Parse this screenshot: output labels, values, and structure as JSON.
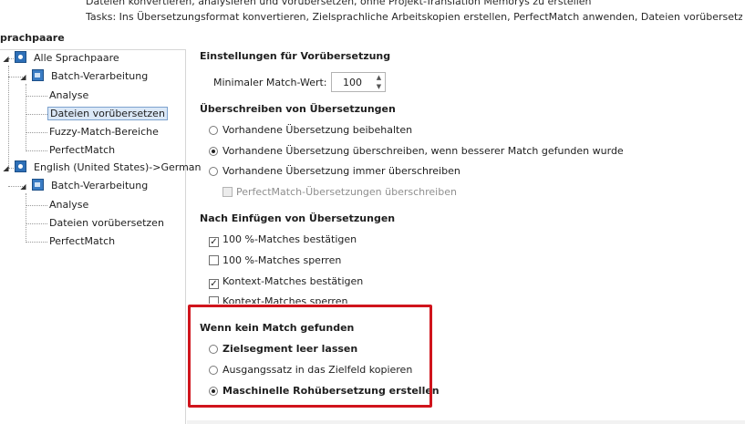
{
  "header": {
    "desc_line1": "Dateien konvertieren, analysieren und vorübersetzen, ohne Projekt-Translation Memorys zu erstellen",
    "desc_line2": "Tasks: Ins Übersetzungsformat konvertieren, Zielsprachliche Arbeitskopien erstellen, PerfectMatch anwenden, Dateien vorübersetzen, Analyse"
  },
  "tree": {
    "title": "prachpaare",
    "nodes": [
      {
        "label": "Alle Sprachpaare"
      },
      {
        "label": "Batch-Verarbeitung"
      },
      {
        "label": "Analyse"
      },
      {
        "label": "Dateien vorübersetzen"
      },
      {
        "label": "Fuzzy-Match-Bereiche"
      },
      {
        "label": "PerfectMatch"
      },
      {
        "label": "English (United States)->German"
      },
      {
        "label": "Batch-Verarbeitung"
      },
      {
        "label": "Analyse"
      },
      {
        "label": "Dateien vorübersetzen"
      },
      {
        "label": "PerfectMatch"
      }
    ],
    "selected_index": 3
  },
  "settings": {
    "section1_title": "Einstellungen für Vorübersetzung",
    "min_match_label": "Minimaler Match-Wert:",
    "min_match_value": "100",
    "section2_title": "Überschreiben von Übersetzungen",
    "overwrite_options": [
      "Vorhandene Übersetzung beibehalten",
      "Vorhandene Übersetzung überschreiben, wenn besserer Match gefunden wurde",
      "Vorhandene Übersetzung immer überschreiben"
    ],
    "overwrite_selected": 1,
    "perfectmatch_overwrite_label": "PerfectMatch-Übersetzungen überschreiben",
    "section3_title": "Nach Einfügen von Übersetzungen",
    "after_insert_options": [
      {
        "label": "100 %-Matches bestätigen",
        "checked": true
      },
      {
        "label": "100 %-Matches sperren",
        "checked": false
      },
      {
        "label": "Kontext-Matches bestätigen",
        "checked": true
      },
      {
        "label": "Kontext-Matches sperren",
        "checked": false
      }
    ],
    "section4_title": "Wenn kein Match gefunden",
    "no_match_options": [
      "Zielsegment leer lassen",
      "Ausgangssatz in das Zielfeld kopieren",
      "Maschinelle Rohübersetzung erstellen"
    ],
    "no_match_selected": 2
  },
  "colors": {
    "highlight": "#d0141c",
    "selection_bg": "#dbe8f7",
    "icon_blue": "#2d6fb7"
  }
}
